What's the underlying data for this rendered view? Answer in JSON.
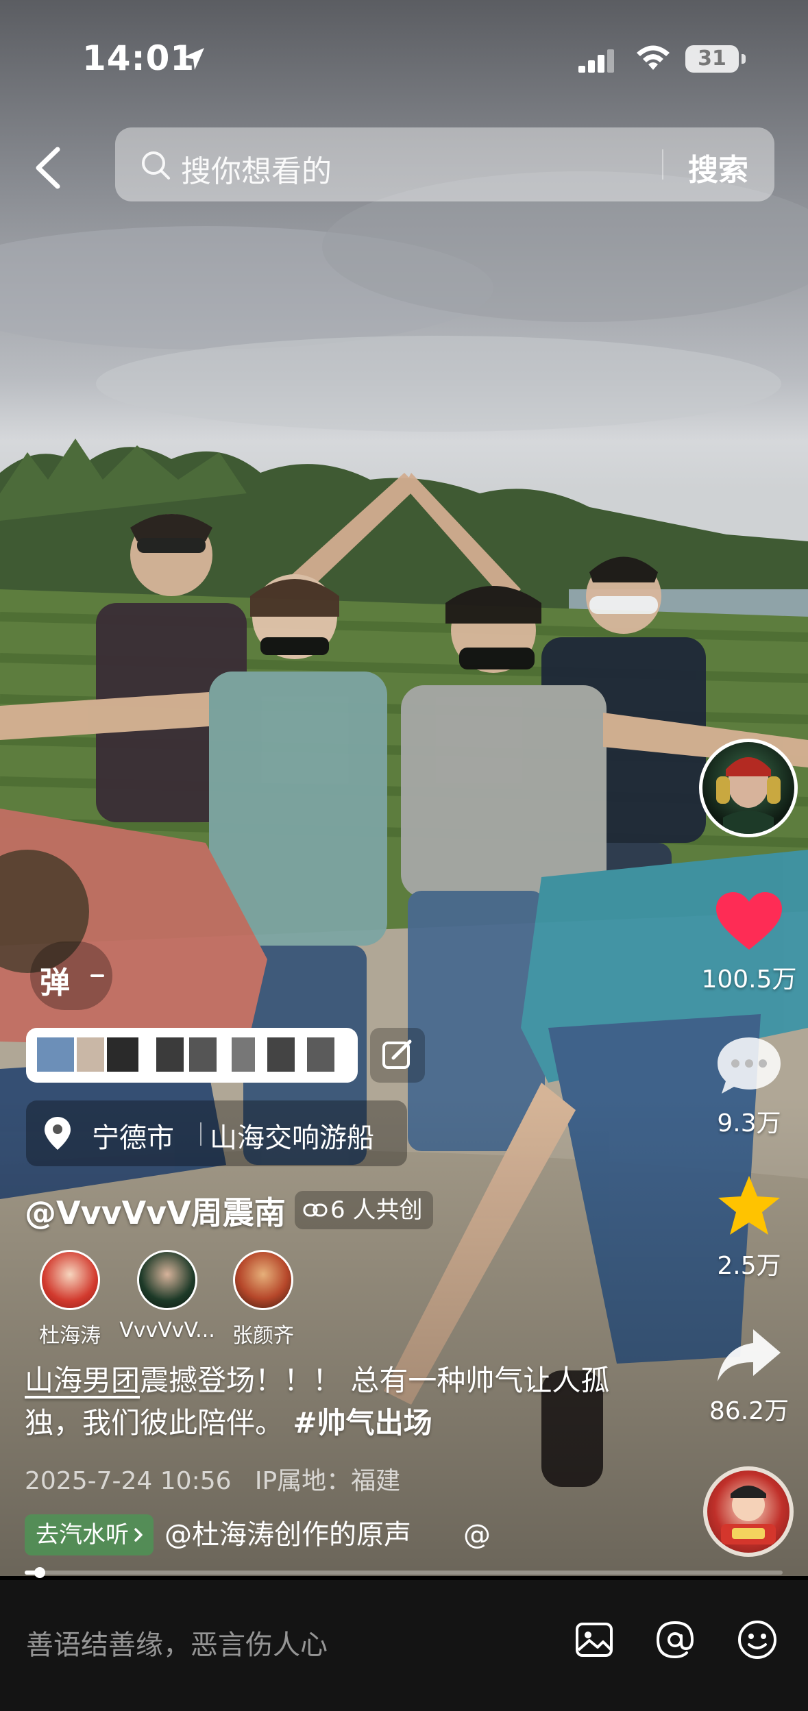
{
  "status_bar": {
    "time": "14:01",
    "battery": "31"
  },
  "search": {
    "placeholder": "搜你想看的",
    "button": "搜索"
  },
  "actions": {
    "likes": "100.5万",
    "comments": "9.3万",
    "favorites": "2.5万",
    "shares": "86.2万"
  },
  "danmu": {
    "label": "弹"
  },
  "location": {
    "city": "宁德市",
    "poi": "山海交响游船"
  },
  "author": {
    "name": "@VvvVvV周震南",
    "cocreate": "6 人共创"
  },
  "creators": [
    {
      "name": "杜海涛"
    },
    {
      "name": "VvvVvV..."
    },
    {
      "name": "张颜齐"
    }
  ],
  "caption": {
    "mention": "山海男团",
    "text": "震撼登场！！！ 总有一种帅气让人孤独，我们彼此陪伴。",
    "hashtag": "#帅气出场"
  },
  "meta": {
    "date": "2025-7-24 10:56",
    "ip": "IP属地：福建"
  },
  "music": {
    "pill": "去汽水听",
    "title": "@杜海涛创作的原声",
    "at": "@"
  },
  "progress": {
    "fraction": 0.02
  },
  "comment_bar": {
    "placeholder": "善语结善缘，恶言伤人心"
  },
  "colors": {
    "like": "#fe2c55",
    "favorite": "#ffc300",
    "comment_bar_bg": "#141414",
    "music_pill": "#3caa50"
  },
  "icons": [
    "back-icon",
    "search-icon",
    "location-arrow-icon",
    "signal-icon",
    "wifi-icon",
    "heart-icon",
    "comment-icon",
    "star-icon",
    "share-icon",
    "location-pin-icon",
    "edit-icon",
    "link-icon",
    "image-icon",
    "at-icon",
    "emoji-icon"
  ]
}
